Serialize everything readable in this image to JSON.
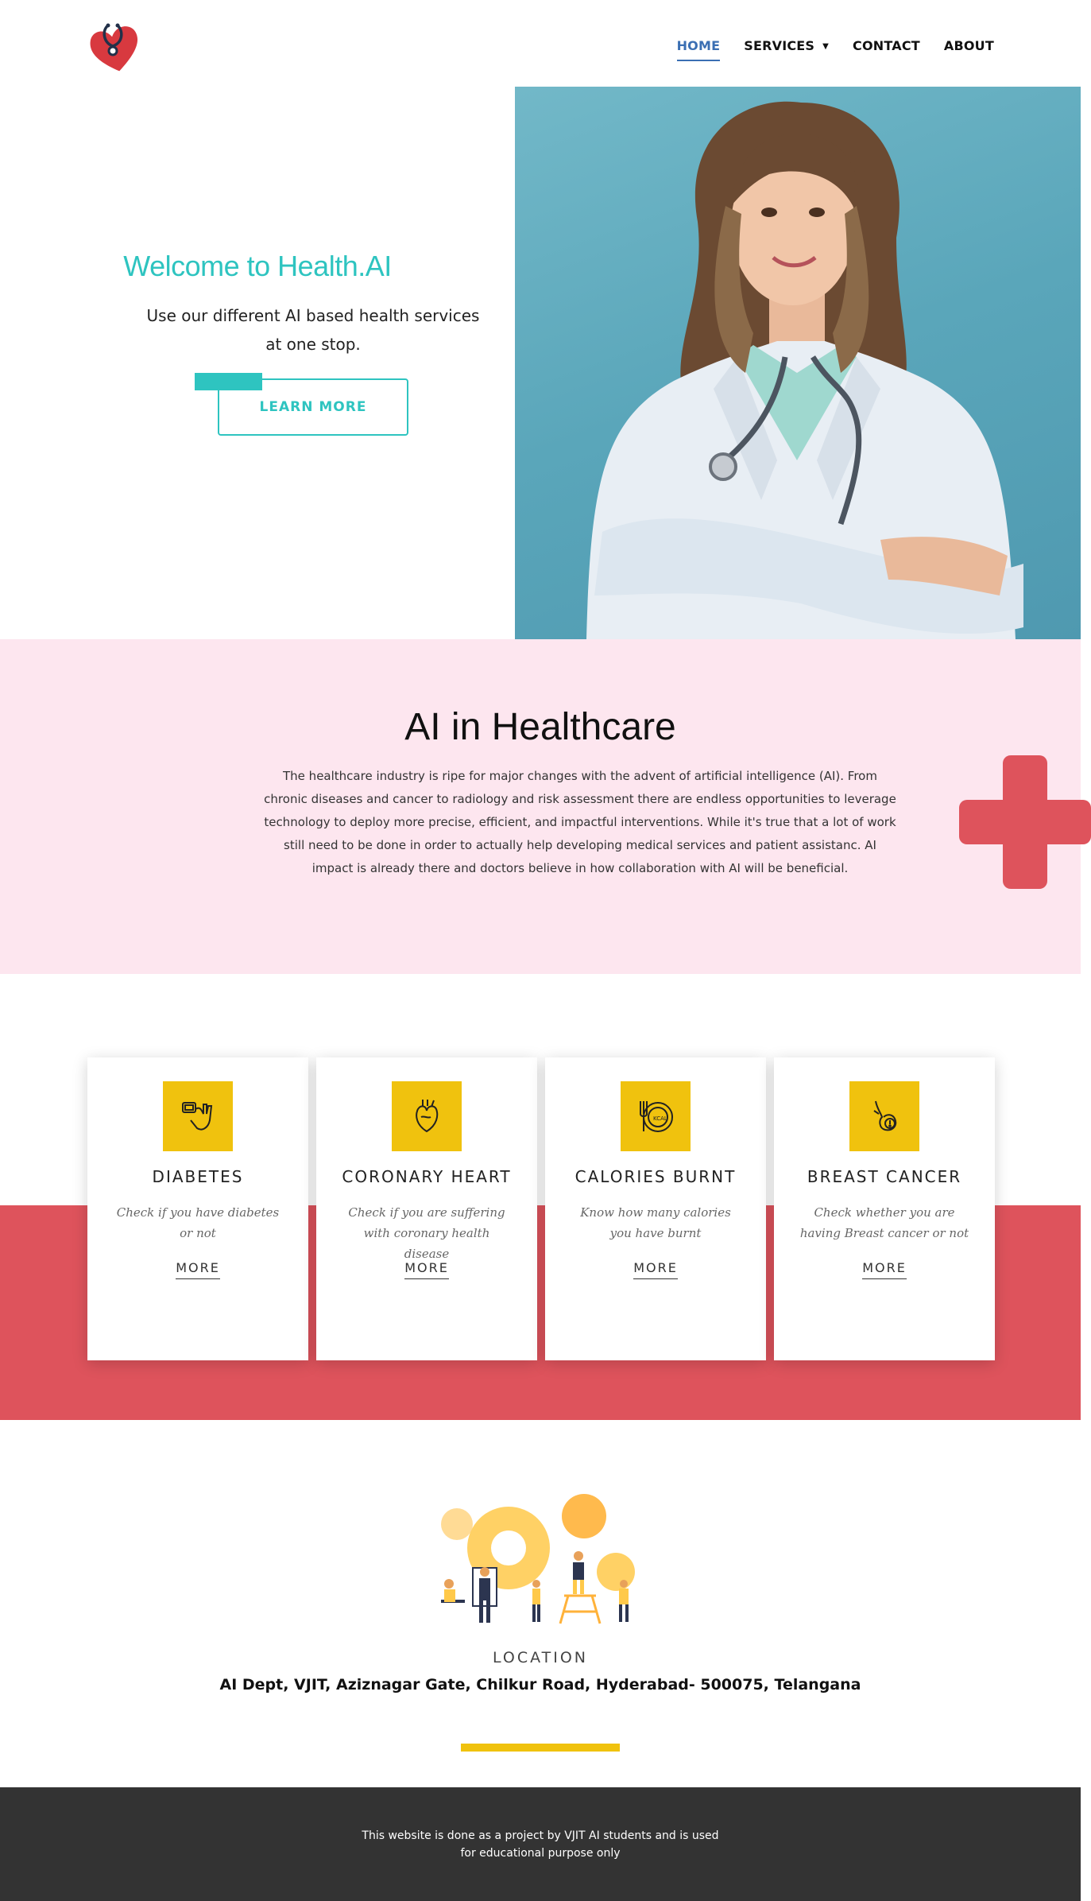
{
  "nav": {
    "logo_icon": "heart-stethoscope-icon",
    "items": [
      {
        "label": "HOME",
        "active": true
      },
      {
        "label": "SERVICES",
        "dropdown": true
      },
      {
        "label": "CONTACT"
      },
      {
        "label": "ABOUT"
      }
    ]
  },
  "hero": {
    "title": "Welcome to Health.AI",
    "subtitle": "Use our different AI based health services at one stop.",
    "button_label": "LEARN MORE",
    "image": "doctor-photo"
  },
  "ai_section": {
    "title": "AI in Healthcare",
    "text": "The healthcare industry is ripe for major changes with the advent of artificial intelligence (AI). From chronic diseases and cancer to radiology and risk assessment there are endless opportunities to leverage technology to deploy more precise, efficient, and impactful interventions. While it's true that a lot of work still need to be done in order to actually help developing medical services and patient assistanc. AI impact is already there and doctors believe in how collaboration with AI will be beneficial."
  },
  "services": [
    {
      "title": "DIABETES",
      "description": "Check if you have diabetes or not",
      "more": "MORE",
      "icon": "glucose-meter-icon"
    },
    {
      "title": "CORONARY HEART",
      "description": "Check if you are suffering with coronary health disease",
      "more": "MORE",
      "icon": "heart-organ-icon"
    },
    {
      "title": "CALORIES BURNT",
      "description": "Know how many calories you have burnt",
      "more": "MORE",
      "icon": "calories-plate-icon"
    },
    {
      "title": "BREAST CANCER",
      "description": "Check whether you are having Breast cancer or not",
      "more": "MORE",
      "icon": "breast-cancer-icon"
    }
  ],
  "location": {
    "label": "LOCATION",
    "address": "AI Dept, VJIT, Aziznagar Gate, Chilkur Road, Hyderabad- 500075, Telangana"
  },
  "footer": {
    "text": "This website is done as a project by VJIT AI students and is used for educational purpose only"
  },
  "colors": {
    "accent_teal": "#2ec4c0",
    "nav_active": "#3b6fb3",
    "pink_bg": "#fde6ef",
    "red": "#de535c",
    "yellow": "#f0c20e",
    "footer_bg": "#333333"
  }
}
